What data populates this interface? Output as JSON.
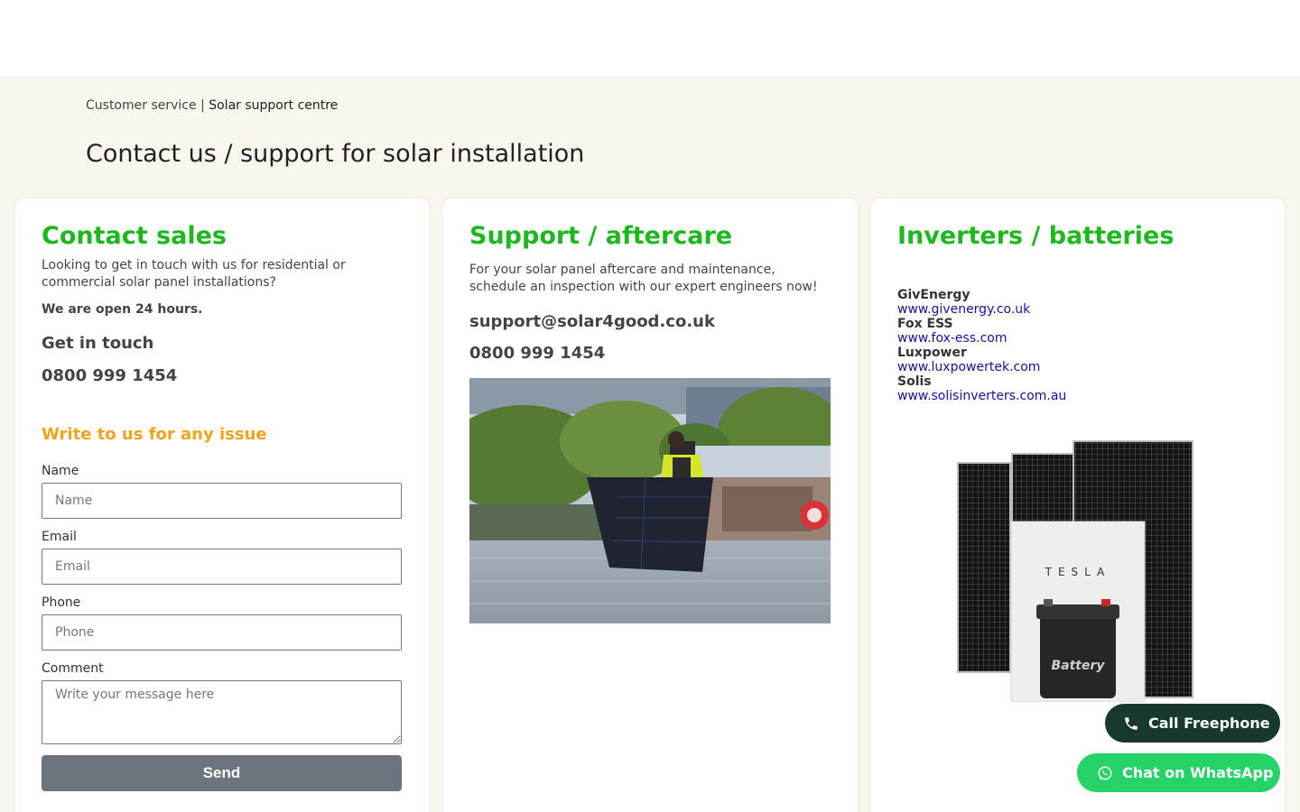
{
  "breadcrumb": {
    "parent": "Customer service",
    "separator": "|",
    "current": "Solar support centre"
  },
  "page_title": "Contact us / support for solar installation",
  "sales": {
    "heading": "Contact sales",
    "intro": "Looking to get in touch with us for residential or commercial solar panel installations?",
    "hours": "We are open 24 hours.",
    "get_in_touch": "Get in touch",
    "phone": "0800 999 1454",
    "form_heading": "Write to us for any issue",
    "form": {
      "name_label": "Name",
      "name_placeholder": "Name",
      "email_label": "Email",
      "email_placeholder": "Email",
      "phone_label": "Phone",
      "phone_placeholder": "Phone",
      "comment_label": "Comment",
      "comment_placeholder": "Write your message here",
      "send_label": "Send"
    }
  },
  "support": {
    "heading": "Support / aftercare",
    "intro": "For your solar panel aftercare and maintenance, schedule an inspection with our expert engineers now!",
    "email": "support@solar4good.co.uk",
    "phone": "0800 999 1454"
  },
  "inverters": {
    "heading": "Inverters / batteries",
    "brands": [
      {
        "name": "GivEnergy",
        "url": "www.givenergy.co.uk"
      },
      {
        "name": "Fox ESS",
        "url": "www.fox-ess.com"
      },
      {
        "name": "Luxpower",
        "url": "www.luxpowertek.com"
      },
      {
        "name": "Solis",
        "url": "www.solisinverters.com.au"
      }
    ],
    "product_labels": {
      "wall_brand": "TESLA",
      "battery": "Battery"
    }
  },
  "floating": {
    "call_label": "Call Freephone",
    "whatsapp_label": "Chat on WhatsApp"
  },
  "colors": {
    "heading_green": "#1db81d",
    "accent_orange": "#f5a21b",
    "background_cream": "#f9f6ee",
    "send_button": "#6c757d",
    "call_button": "#173a2c",
    "whatsapp_button": "#25d366",
    "link": "#1a0dab"
  }
}
